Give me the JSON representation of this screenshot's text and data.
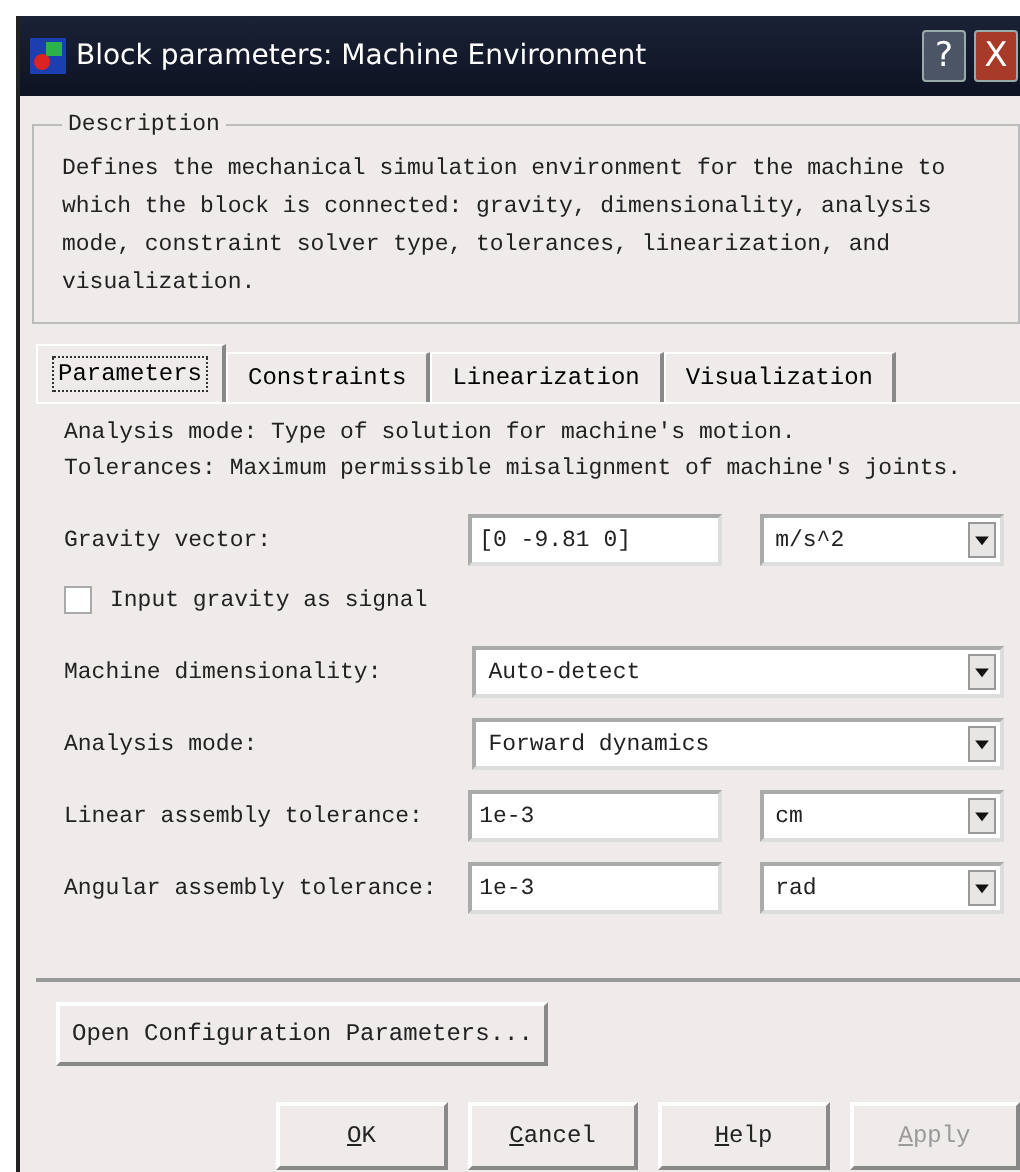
{
  "window": {
    "title": "Block parameters:  Machine Environment",
    "buttons": [
      "?",
      "X"
    ]
  },
  "description": {
    "legend": "Description",
    "text": "Defines the mechanical simulation environment for the machine to which the block is connected: gravity, dimensionality, analysis mode, constraint solver type, tolerances, linearization, and visualization."
  },
  "tabs": [
    {
      "label": "Parameters",
      "selected": true
    },
    {
      "label": "Constraints",
      "selected": false
    },
    {
      "label": "Linearization",
      "selected": false
    },
    {
      "label": "Visualization",
      "selected": false
    }
  ],
  "panel": {
    "notes": [
      "Analysis mode: Type of solution for machine's motion.",
      "Tolerances: Maximum permissible misalignment of machine's joints."
    ],
    "rows": [
      {
        "kind": "field-unit",
        "label": "Gravity vector:",
        "value": "[0 -9.81 0]",
        "unit": "m/s^2"
      },
      {
        "kind": "checkbox",
        "label": "Input gravity as signal",
        "checked": false
      },
      {
        "kind": "dropdown",
        "label": "Machine dimensionality:",
        "value": "Auto-detect"
      },
      {
        "kind": "dropdown",
        "label": "Analysis mode:",
        "value": "Forward dynamics"
      },
      {
        "kind": "field-unit",
        "label": "Linear assembly tolerance:",
        "value": "1e-3",
        "unit": "cm"
      },
      {
        "kind": "field-unit",
        "label": "Angular assembly tolerance:",
        "value": "1e-3",
        "unit": "rad"
      }
    ]
  },
  "config_button": "Open Configuration Parameters...",
  "buttons": [
    {
      "mnemonic": "O",
      "rest": "K",
      "disabled": false
    },
    {
      "mnemonic": "C",
      "rest": "ancel",
      "disabled": false
    },
    {
      "mnemonic": "H",
      "rest": "elp",
      "disabled": false
    },
    {
      "mnemonic": "A",
      "rest": "pply",
      "disabled": true
    }
  ]
}
